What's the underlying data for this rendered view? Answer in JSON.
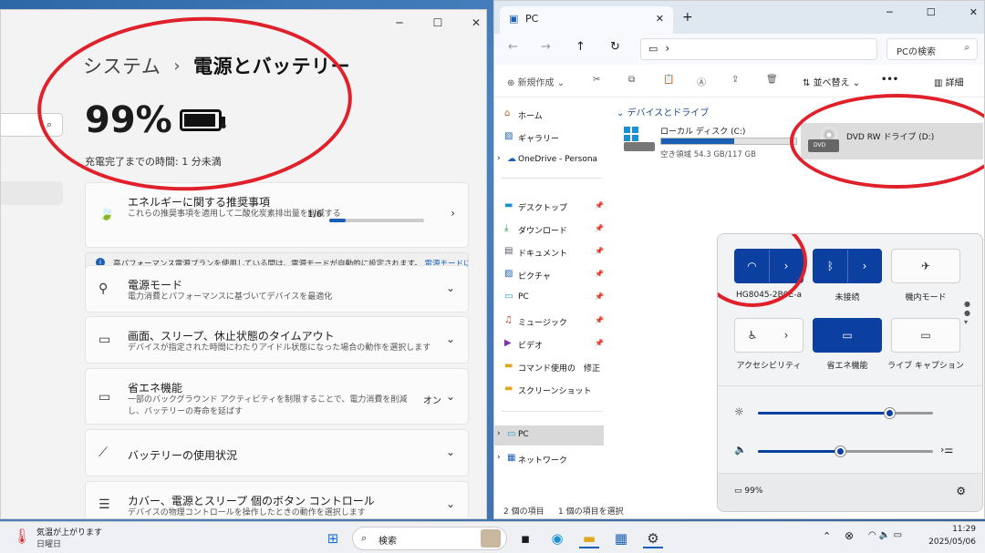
{
  "settings": {
    "breadcrumb_system": "システム",
    "breadcrumb_sep": "›",
    "breadcrumb_current": "電源とバッテリー",
    "battery_percent": "99%",
    "charge_time": "充電完了までの時間: 1 分未満",
    "cards": [
      {
        "title": "エネルギーに関する推奨事項",
        "desc": "これらの推奨事項を適用して二酸化炭素排出量を削減する",
        "count": "1/6",
        "progress": 0.17
      },
      {
        "title": "電源モード",
        "desc": "電力消費とパフォーマンスに基づいてデバイスを最適化"
      },
      {
        "title": "画面、スリープ、休止状態のタイムアウト",
        "desc": "デバイスが指定された時間にわたりアイドル状態になった場合の動作を選択します"
      },
      {
        "title": "省エネ機能",
        "desc": "一部のバックグラウンド アクティビティを制限することで、電力消費を削減し、バッテリーの寿命を延ばす",
        "value": "オン"
      },
      {
        "title": "バッテリーの使用状況",
        "desc": ""
      },
      {
        "title": "カバー、電源とスリープ 個のボタン コントロール",
        "desc": "デバイスの物理コントロールを操作したときの動作を選択します"
      }
    ],
    "notice": "高パフォーマンス電源プランを使用している間は、電源モードが自動的に設定されます。",
    "notice_link": "電源モードに関する詳細"
  },
  "explorer": {
    "tab_title": "PC",
    "address": "›",
    "search_placeholder": "PCの検索",
    "toolbar": {
      "new": "新規作成",
      "sort": "並べ替え",
      "more": "•••",
      "details": "詳細"
    },
    "nav": [
      {
        "label": "ホーム",
        "icon": "home-icon"
      },
      {
        "label": "ギャラリー",
        "icon": "gallery-icon"
      },
      {
        "label": "OneDrive - Persona",
        "icon": "cloud-icon"
      },
      {
        "label": "デスクトップ",
        "icon": "desktop-icon"
      },
      {
        "label": "ダウンロード",
        "icon": "download-icon"
      },
      {
        "label": "ドキュメント",
        "icon": "document-icon"
      },
      {
        "label": "ピクチャ",
        "icon": "picture-icon"
      },
      {
        "label": "PC",
        "icon": "pc-icon"
      },
      {
        "label": "ミュージック",
        "icon": "music-icon"
      },
      {
        "label": "ビデオ",
        "icon": "video-icon"
      },
      {
        "label": "コマンド使用の　修正",
        "icon": "folder-icon"
      },
      {
        "label": "スクリーンショット",
        "icon": "folder-icon"
      },
      {
        "label": "PC",
        "icon": "pc-icon"
      },
      {
        "label": "ネットワーク",
        "icon": "network-icon"
      }
    ],
    "section_header": "デバイスとドライブ",
    "drive_c": {
      "name": "ローカル ディスク (C:)",
      "free": "空き領域 54.3 GB/117 GB",
      "used_fraction": 0.54
    },
    "drive_d": {
      "name": "DVD RW ドライブ (D:)",
      "badge": "DVD"
    },
    "status_items": "2 個の項目",
    "status_selected": "1 個の項目を選択"
  },
  "quick_settings": {
    "wifi_label": "HG8045-2B0E-a",
    "bluetooth_label": "未接続",
    "airplane_label": "機内モード",
    "accessibility_label": "アクセシビリティ",
    "energy_label": "省エネ機能",
    "caption_label": "ライブ キャプション",
    "brightness": 0.75,
    "volume": 0.47,
    "battery": "99%"
  },
  "taskbar": {
    "weather_title": "気温が上がります",
    "weather_sub": "日曜日",
    "search": "検索",
    "time": "11:29",
    "date": "2025/05/06"
  },
  "colors": {
    "accent": "#0b3fa0",
    "annotation": "#e0202a"
  }
}
